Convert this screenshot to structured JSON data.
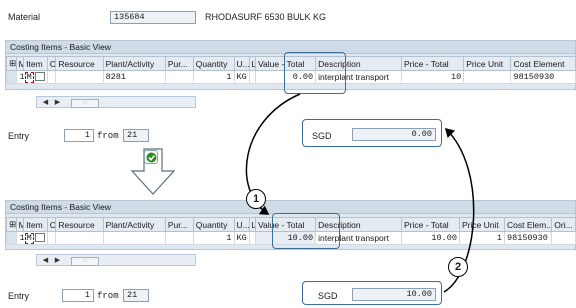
{
  "material": {
    "label": "Material",
    "code": "135684",
    "description": "RHODASURF 6530 BULK KG"
  },
  "costing_panel": {
    "title": "Costing Items - Basic View"
  },
  "top_table": {
    "headers": [
      "",
      "M",
      "Item",
      "C",
      "Resource",
      "Plant/Activity",
      "Pur...",
      "Quantity",
      "U...",
      "L",
      "Value - Total",
      "Description",
      "Price - Total",
      "Price Unit",
      "Cost Element"
    ],
    "row": {
      "item": "1",
      "category": "M",
      "plant_activity": "8281",
      "quantity": "1",
      "unit": "KG",
      "value_total": "0.00",
      "description": "interplant transport",
      "price_total": "10",
      "price_unit": "",
      "cost_element": "98150930"
    }
  },
  "bottom_table": {
    "headers": [
      "",
      "M",
      "Item",
      "C",
      "Resource",
      "Plant/Activity",
      "Pur...",
      "Quantity",
      "U...",
      "L",
      "Value - Total",
      "Description",
      "Price - Total",
      "Price Unit",
      "Cost Elem...",
      "Ori..."
    ],
    "row": {
      "item": "1",
      "category": "M",
      "plant_activity": "",
      "quantity": "1",
      "unit": "KG",
      "value_total": "10.00",
      "description": "interplant transport",
      "price_total": "10.00",
      "price_unit": "1",
      "cost_element": "98150930"
    }
  },
  "nav": {
    "left": "◀",
    "right": "▶",
    "thumb": ":::"
  },
  "entry_top": {
    "label": "Entry",
    "value": "1",
    "from_label": "from",
    "total": "21"
  },
  "entry_bottom": {
    "label": "Entry",
    "value": "1",
    "from_label": "from",
    "total": "21"
  },
  "total_top": {
    "currency": "SGD",
    "value": "0.00"
  },
  "total_bottom": {
    "currency": "SGD",
    "value": "10.00"
  },
  "badges": {
    "one": "1",
    "two": "2"
  },
  "colors": {
    "highlight": "#3a6f9a",
    "check": "#2f8a1f",
    "panel": "#dfe8f0"
  },
  "icons": {
    "confirm": "check-icon",
    "arrow": "down-arrow-icon",
    "copy": "copy-icon"
  }
}
